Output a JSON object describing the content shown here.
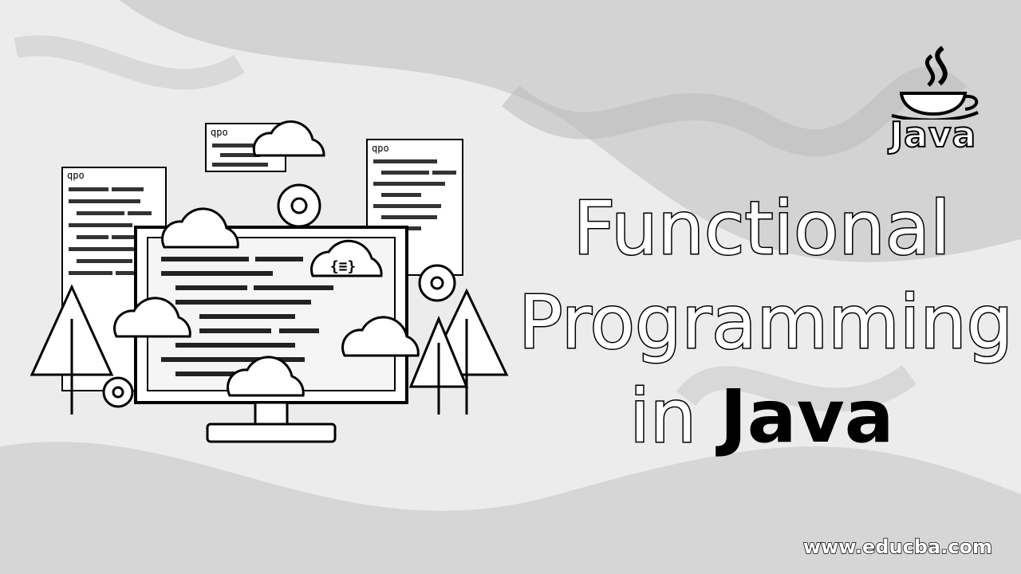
{
  "background": {
    "color": "#e9e9e9",
    "swirl_color": "#b9b9b9"
  },
  "logo": {
    "word": "Java",
    "icon": "java-coffee-cup-icon"
  },
  "title": {
    "line1": "Functional",
    "line2": "Programming",
    "line3_prefix": "in",
    "line3_emphasis": "Java"
  },
  "footer": {
    "url": "www.educba.com"
  },
  "illustration": {
    "code_tag_1": "qpo",
    "code_tag_2": "qpo",
    "code_tag_3": "qpo",
    "cloud_badge": "{≡}",
    "icons": [
      "computer-monitor-icon",
      "cloud-icon",
      "gear-icon",
      "tree-icon"
    ]
  }
}
